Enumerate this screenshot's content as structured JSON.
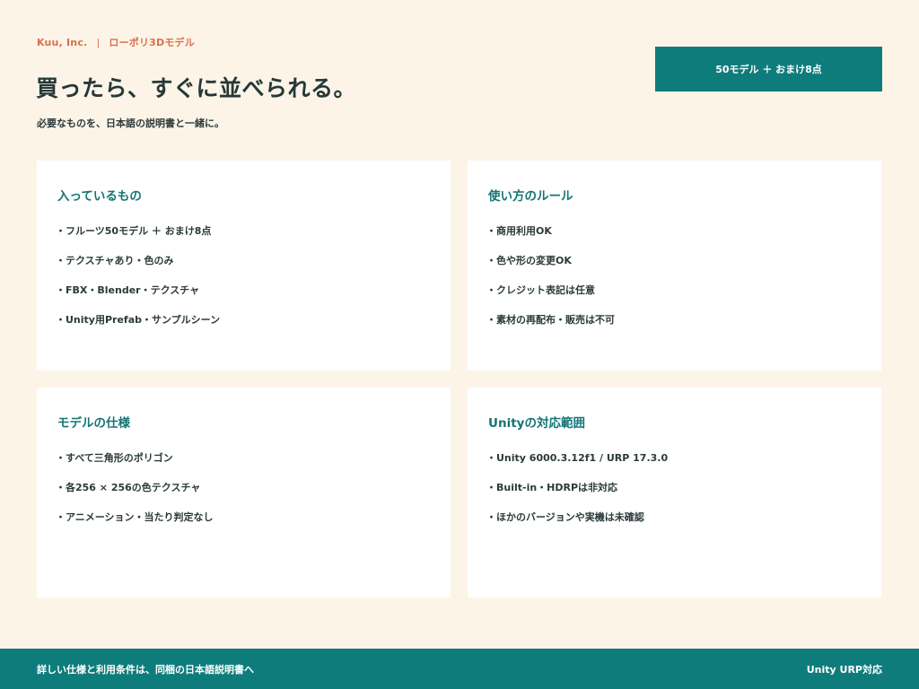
{
  "header": {
    "company": "Kuu, Inc.",
    "separator": "|",
    "product": "ローポリ3Dモデル",
    "headline": "買ったら、すぐに並べられる。",
    "subline": "必要なものを、日本語の説明書と一緒に。",
    "badge": "50モデル ＋ おまけ8点"
  },
  "cards": [
    {
      "title": "入っているもの",
      "items": [
        "フルーツ50モデル ＋ おまけ8点",
        "テクスチャあり・色のみ",
        "FBX・Blender・テクスチャ",
        "Unity用Prefab・サンプルシーン"
      ]
    },
    {
      "title": "使い方のルール",
      "items": [
        "商用利用OK",
        "色や形の変更OK",
        "クレジット表記は任意",
        "素材の再配布・販売は不可"
      ]
    },
    {
      "title": "モデルの仕様",
      "items": [
        "すべて三角形のポリゴン",
        "各256 × 256の色テクスチャ",
        "アニメーション・当たり判定なし"
      ]
    },
    {
      "title": "Unityの対応範囲",
      "items": [
        "Unity 6000.3.12f1 / URP 17.3.0",
        "Built-in・HDRPは非対応",
        "ほかのバージョンや実機は未確認"
      ]
    }
  ],
  "footer": {
    "left": "詳しい仕様と利用条件は、同梱の日本語説明書へ",
    "right": "Unity URP対応"
  },
  "colors": {
    "accent": "#0f7c7c",
    "brand": "#d9704a",
    "background": "#fdf4e8"
  }
}
